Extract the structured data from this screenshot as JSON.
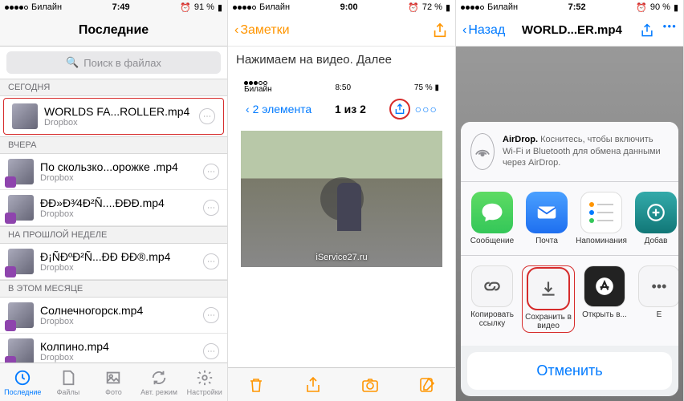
{
  "phone1": {
    "status": {
      "carrier": "Билайн",
      "time": "7:49",
      "alarm": "⏰",
      "battery": "91 %"
    },
    "nav": {
      "title": "Последние"
    },
    "search": {
      "placeholder": "Поиск в файлах"
    },
    "sections": [
      {
        "title": "СЕГОДНЯ",
        "items": [
          {
            "name": "WORLDS FA...ROLLER.mp4",
            "sub": "Dropbox",
            "highlight": true,
            "badge": false
          }
        ]
      },
      {
        "title": "ВЧЕРА",
        "items": [
          {
            "name": "По скользко...орожке .mp4",
            "sub": "Dropbox",
            "highlight": false,
            "badge": true
          },
          {
            "name": "ÐÐ»Ð³⁄4Ð²Ñ....ÐÐÐ.mp4",
            "sub": "Dropbox",
            "highlight": false,
            "badge": true
          }
        ]
      },
      {
        "title": "НА ПРОШЛОЙ НЕДЕЛЕ",
        "items": [
          {
            "name": "Ð¡ÑÐºÐ²Ñ...ÐÐ ÐÐ®.mp4",
            "sub": "Dropbox",
            "highlight": false,
            "badge": true
          }
        ]
      },
      {
        "title": "В ЭТОМ МЕСЯЦЕ",
        "items": [
          {
            "name": "Солнечногорск.mp4",
            "sub": "Dropbox",
            "highlight": false,
            "badge": true
          },
          {
            "name": "Колпино.mp4",
            "sub": "Dropbox",
            "highlight": false,
            "badge": true
          }
        ]
      }
    ],
    "tabs": [
      {
        "label": "Последние",
        "active": true
      },
      {
        "label": "Файлы",
        "active": false
      },
      {
        "label": "Фото",
        "active": false
      },
      {
        "label": "Авт. режим",
        "active": false
      },
      {
        "label": "Настройки",
        "active": false
      }
    ]
  },
  "phone2": {
    "status": {
      "carrier": "Билайн",
      "time": "9:00",
      "alarm": "⏰",
      "battery": "72 %"
    },
    "nav": {
      "back": "Заметки"
    },
    "note_text": "Нажимаем на видео. Далее",
    "inner": {
      "status": {
        "carrier": "Билайн",
        "time": "8:50",
        "battery": "75 %"
      },
      "back": "2 элемента",
      "counter": "1 из 2"
    },
    "watermark": "iService27.ru",
    "toolbar_icons": [
      "trash",
      "share",
      "camera",
      "compose"
    ]
  },
  "phone3": {
    "status": {
      "carrier": "Билайн",
      "time": "7:52",
      "alarm": "⏰",
      "battery": "90 %"
    },
    "nav": {
      "back": "Назад",
      "title": "WORLD...ER.mp4"
    },
    "airdrop": {
      "title": "AirDrop.",
      "text": "Коснитесь, чтобы включить Wi-Fi и Bluetooth для обмена данными через AirDrop."
    },
    "share_apps": [
      {
        "label": "Сообщение"
      },
      {
        "label": "Почта"
      },
      {
        "label": "Напоминания"
      },
      {
        "label": "Добав"
      }
    ],
    "actions": [
      {
        "label": "Копировать ссылку"
      },
      {
        "label": "Сохранить в видео",
        "highlight": true
      },
      {
        "label": "Открыть в..."
      },
      {
        "label": "Е"
      }
    ],
    "cancel": "Отменить"
  }
}
